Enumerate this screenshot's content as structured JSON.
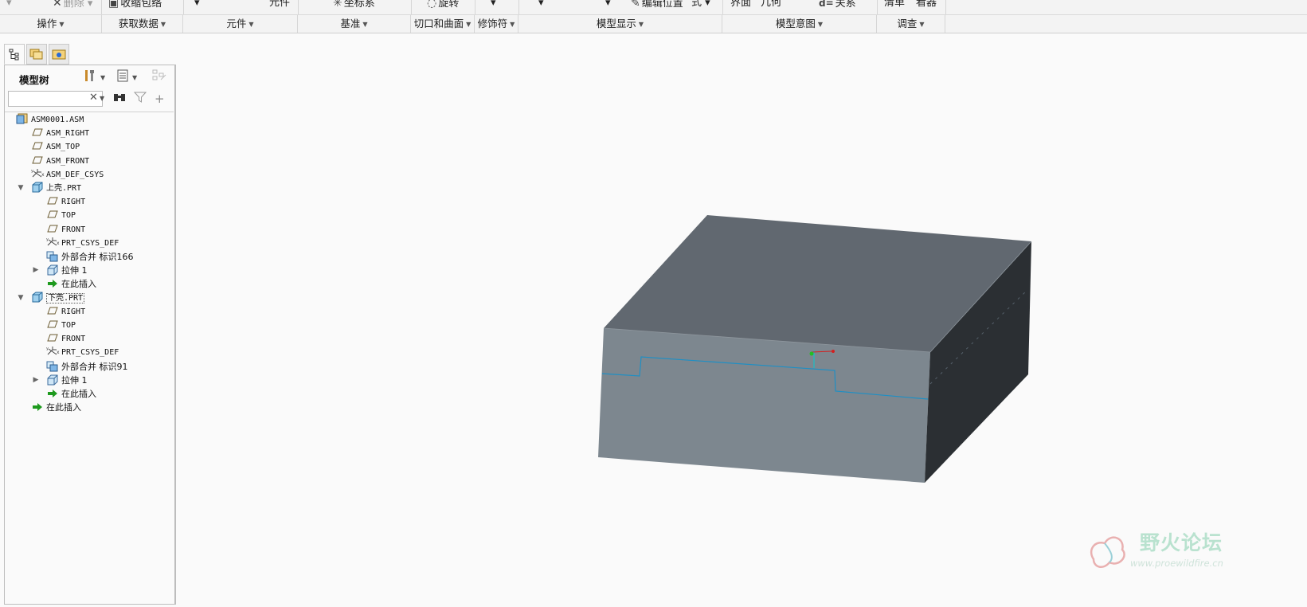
{
  "ribbon": {
    "top_fragments": [
      {
        "name": "delete-cmd",
        "text": "删除",
        "icon": "✕",
        "gray": true
      },
      {
        "name": "shrinkwrap-cmd",
        "text": "收缩包络",
        "icon": "▣",
        "gray": false
      },
      {
        "name": "component-cmd",
        "text": "元件",
        "icon": "",
        "gray": false
      },
      {
        "name": "coord-system-cmd",
        "text": "坐标系",
        "icon": "✳",
        "gray": false
      },
      {
        "name": "revolve-cmd",
        "text": "旋转",
        "icon": "◌",
        "gray": false
      },
      {
        "name": "edit-position-cmd",
        "text": "编辑位置",
        "icon": "✎",
        "gray": false
      },
      {
        "name": "style-cmd",
        "text": "式",
        "icon": "",
        "gray": false
      },
      {
        "name": "interface-cmd",
        "text": "界面",
        "icon": "",
        "gray": false
      },
      {
        "name": "geometry-cmd",
        "text": "几何",
        "icon": "",
        "gray": false
      },
      {
        "name": "relations-cmd",
        "text": "关系",
        "icon": "d=",
        "gray": false
      },
      {
        "name": "bom-cmd",
        "text": "清单",
        "icon": "",
        "gray": false
      },
      {
        "name": "viewer-cmd",
        "text": "看器",
        "icon": "",
        "gray": false
      }
    ],
    "groups": [
      {
        "label": "操作"
      },
      {
        "label": "获取数据"
      },
      {
        "label": "元件"
      },
      {
        "label": "基准"
      },
      {
        "label": "切口和曲面"
      },
      {
        "label": "修饰符"
      },
      {
        "label": "模型显示"
      },
      {
        "label": "模型意图"
      },
      {
        "label": "调查"
      }
    ]
  },
  "panel": {
    "title": "模型树",
    "search_placeholder": "",
    "tabs": [
      "model-tree-tab",
      "layer-tab",
      "favorites-tab"
    ]
  },
  "tree": [
    {
      "label": "ASM0001.ASM",
      "icon": "assembly",
      "depth": 0,
      "toggle": "",
      "cjk": false
    },
    {
      "label": "ASM_RIGHT",
      "icon": "plane",
      "depth": 1,
      "toggle": "",
      "cjk": false
    },
    {
      "label": "ASM_TOP",
      "icon": "plane",
      "depth": 1,
      "toggle": "",
      "cjk": false
    },
    {
      "label": "ASM_FRONT",
      "icon": "plane",
      "depth": 1,
      "toggle": "",
      "cjk": false
    },
    {
      "label": "ASM_DEF_CSYS",
      "icon": "csys",
      "depth": 1,
      "toggle": "",
      "cjk": false
    },
    {
      "label": "上壳.PRT",
      "icon": "part",
      "depth": 1,
      "toggle": "▼",
      "cjk": false
    },
    {
      "label": "RIGHT",
      "icon": "plane",
      "depth": 2,
      "toggle": "",
      "cjk": false
    },
    {
      "label": "TOP",
      "icon": "plane",
      "depth": 2,
      "toggle": "",
      "cjk": false
    },
    {
      "label": "FRONT",
      "icon": "plane",
      "depth": 2,
      "toggle": "",
      "cjk": false
    },
    {
      "label": "PRT_CSYS_DEF",
      "icon": "csys",
      "depth": 2,
      "toggle": "",
      "cjk": false
    },
    {
      "label": "外部合并 标识166",
      "icon": "merge",
      "depth": 2,
      "toggle": "",
      "cjk": true
    },
    {
      "label": "拉伸 1",
      "icon": "extrude",
      "depth": 2,
      "toggle": "▶",
      "cjk": true
    },
    {
      "label": "在此插入",
      "icon": "insert",
      "depth": 2,
      "toggle": "",
      "cjk": true
    },
    {
      "label": "下壳.PRT",
      "icon": "part",
      "depth": 1,
      "toggle": "▼",
      "cjk": false,
      "boxed": true
    },
    {
      "label": "RIGHT",
      "icon": "plane",
      "depth": 2,
      "toggle": "",
      "cjk": false
    },
    {
      "label": "TOP",
      "icon": "plane",
      "depth": 2,
      "toggle": "",
      "cjk": false
    },
    {
      "label": "FRONT",
      "icon": "plane",
      "depth": 2,
      "toggle": "",
      "cjk": false
    },
    {
      "label": "PRT_CSYS_DEF",
      "icon": "csys",
      "depth": 2,
      "toggle": "",
      "cjk": false
    },
    {
      "label": "外部合并 标识91",
      "icon": "merge",
      "depth": 2,
      "toggle": "",
      "cjk": true
    },
    {
      "label": "拉伸 1",
      "icon": "extrude",
      "depth": 2,
      "toggle": "▶",
      "cjk": true
    },
    {
      "label": "在此插入",
      "icon": "insert",
      "depth": 2,
      "toggle": "",
      "cjk": true
    },
    {
      "label": "在此插入",
      "icon": "insert",
      "depth": 1,
      "toggle": "",
      "cjk": true
    }
  ],
  "watermark": {
    "title": "野火论坛",
    "url": "www.proewildfire.cn"
  },
  "colors": {
    "box_top": "#616870",
    "box_front": "#7d878f",
    "box_side": "#2b2f33",
    "parting_line": "#1f8fc4"
  }
}
